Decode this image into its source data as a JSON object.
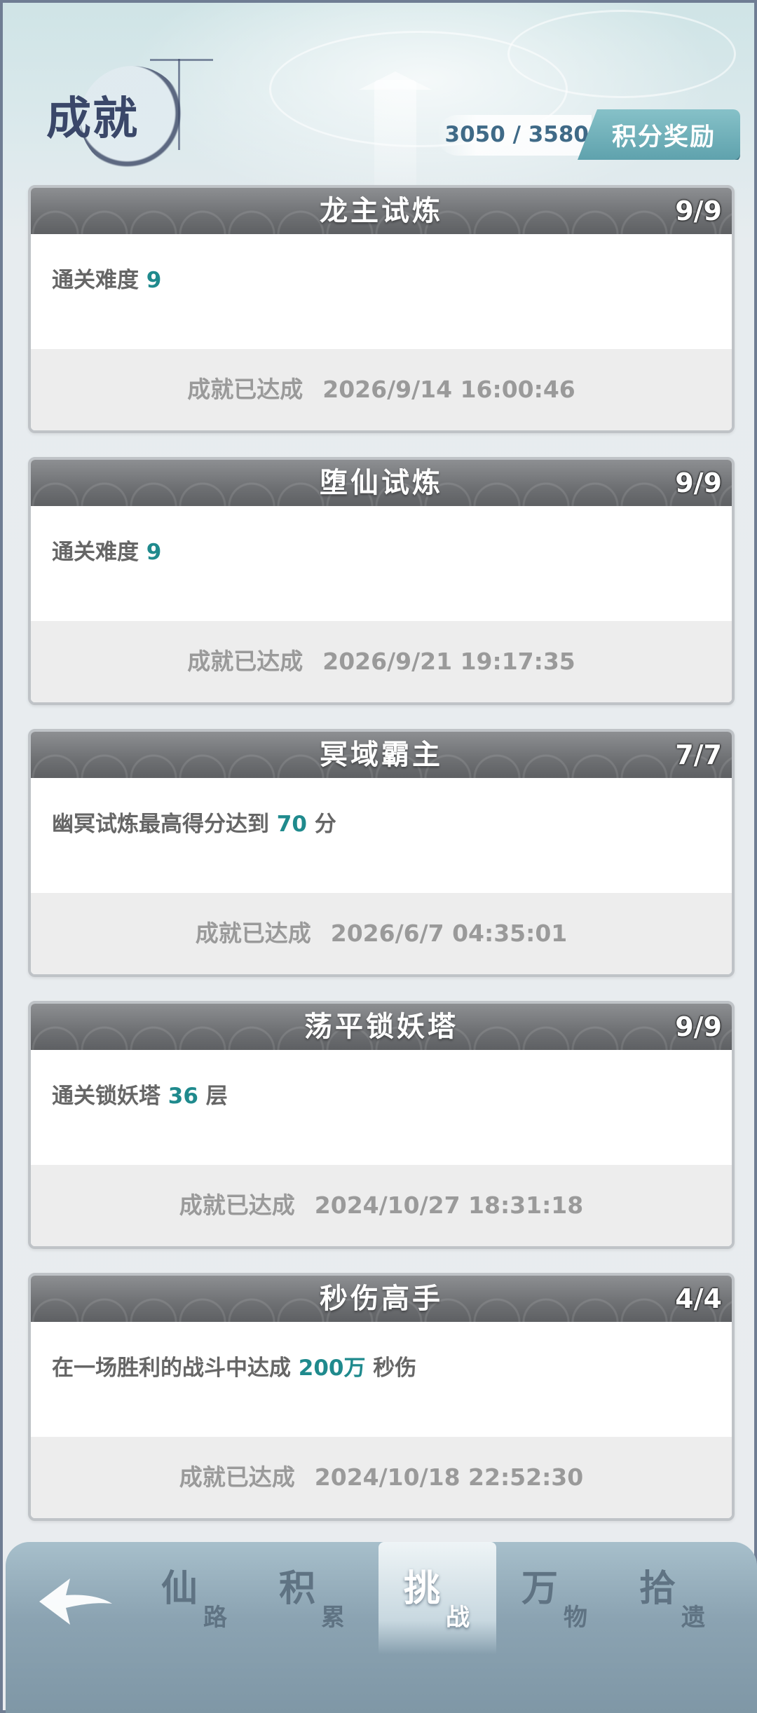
{
  "header": {
    "title": "成就",
    "points": "3050 / 3580",
    "reward_button": "积分奖励"
  },
  "achievements": [
    {
      "title": "龙主试炼",
      "count": "9/9",
      "desc_prefix": "通关难度 ",
      "desc_value": "9",
      "desc_suffix": "",
      "status": "成就已达成",
      "time": "2026/9/14 16:00:46"
    },
    {
      "title": "堕仙试炼",
      "count": "9/9",
      "desc_prefix": "通关难度 ",
      "desc_value": "9",
      "desc_suffix": "",
      "status": "成就已达成",
      "time": "2026/9/21 19:17:35"
    },
    {
      "title": "冥域霸主",
      "count": "7/7",
      "desc_prefix": "幽冥试炼最高得分达到 ",
      "desc_value": "70",
      "desc_suffix": " 分",
      "status": "成就已达成",
      "time": "2026/6/7 04:35:01"
    },
    {
      "title": "荡平锁妖塔",
      "count": "9/9",
      "desc_prefix": "通关锁妖塔 ",
      "desc_value": "36",
      "desc_suffix": " 层",
      "status": "成就已达成",
      "time": "2024/10/27 18:31:18"
    },
    {
      "title": "秒伤高手",
      "count": "4/4",
      "desc_prefix": "在一场胜利的战斗中达成 ",
      "desc_value": "200万",
      "desc_suffix": " 秒伤",
      "status": "成就已达成",
      "time": "2024/10/18 22:52:30"
    }
  ],
  "nav": {
    "back_icon": "back-arrow-icon",
    "tabs": [
      {
        "big": "仙",
        "small": "路"
      },
      {
        "big": "积",
        "small": "累"
      },
      {
        "big": "挑",
        "small": "战"
      },
      {
        "big": "万",
        "small": "物"
      },
      {
        "big": "拾",
        "small": "遗"
      }
    ],
    "active_tab": 2
  },
  "colors": {
    "accent_teal": "#1f8a8d",
    "reward_button": "#6fafb8",
    "title_ink": "#3a4769"
  }
}
